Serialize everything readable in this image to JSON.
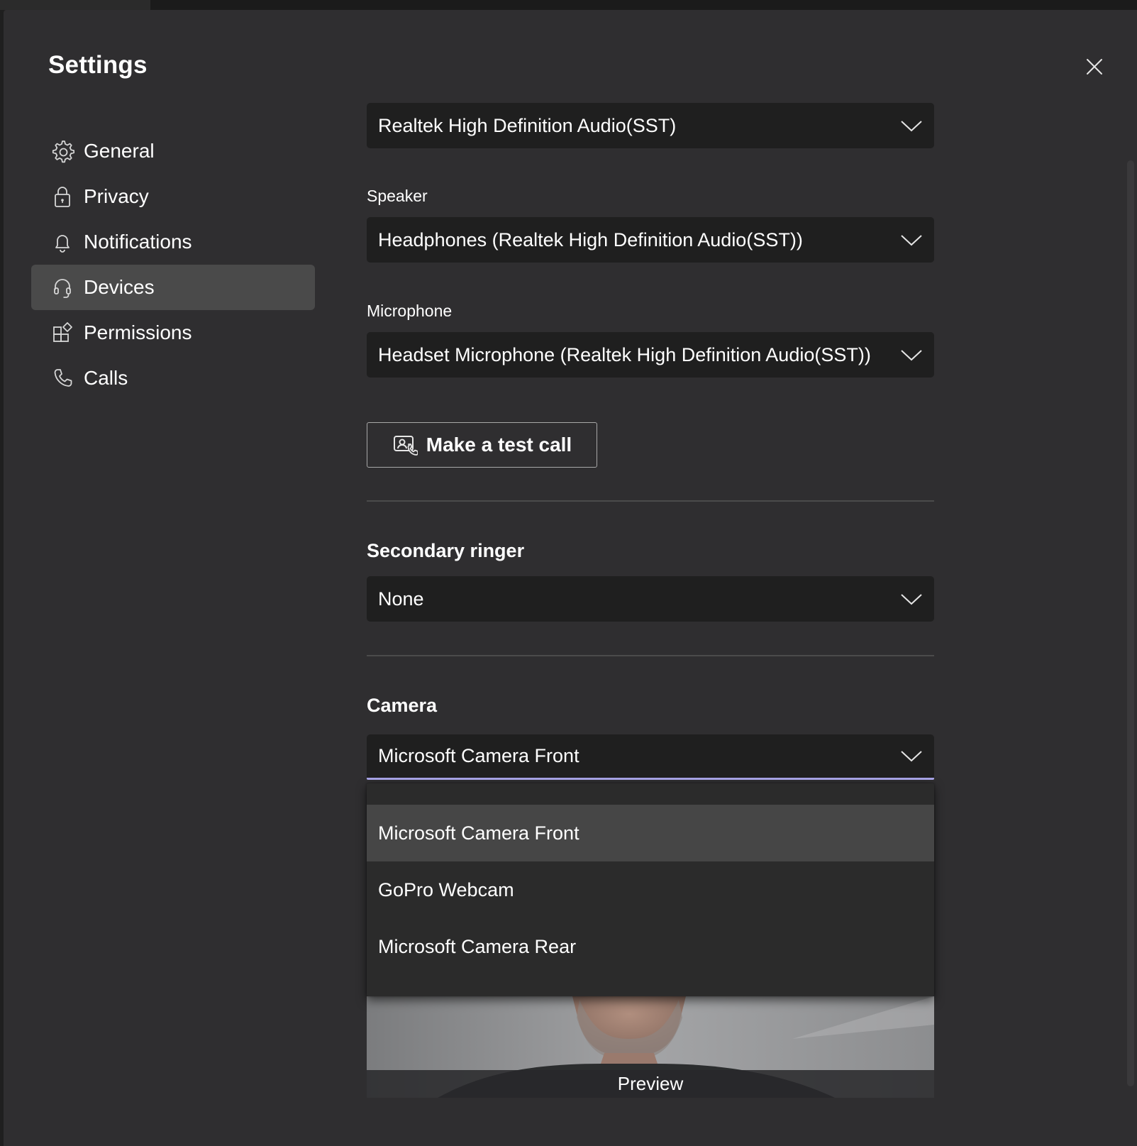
{
  "dialog": {
    "title": "Settings"
  },
  "nav": {
    "items": [
      {
        "label": "General",
        "icon": "gear-icon"
      },
      {
        "label": "Privacy",
        "icon": "lock-icon"
      },
      {
        "label": "Notifications",
        "icon": "bell-icon"
      },
      {
        "label": "Devices",
        "icon": "headset-icon",
        "selected": true
      },
      {
        "label": "Permissions",
        "icon": "permissions-icon"
      },
      {
        "label": "Calls",
        "icon": "phone-icon"
      }
    ]
  },
  "devices": {
    "audio_device_value": "Realtek High Definition Audio(SST)",
    "speaker_label": "Speaker",
    "speaker_value": "Headphones (Realtek High Definition Audio(SST))",
    "microphone_label": "Microphone",
    "microphone_value": "Headset Microphone (Realtek High Definition Audio(SST))",
    "test_call_label": "Make a test call",
    "secondary_ringer_heading": "Secondary ringer",
    "secondary_ringer_value": "None",
    "camera_heading": "Camera",
    "camera_value": "Microsoft Camera Front",
    "camera_options": [
      "Microsoft Camera Front",
      "GoPro Webcam",
      "Microsoft Camera Rear"
    ],
    "preview_label": "Preview"
  },
  "colors": {
    "background": "#2f2e30",
    "select_background": "#1f1f1f",
    "selected_nav": "#4a4a4a",
    "focus_underline": "#a7a3e6",
    "highlighted_option": "#464646"
  }
}
